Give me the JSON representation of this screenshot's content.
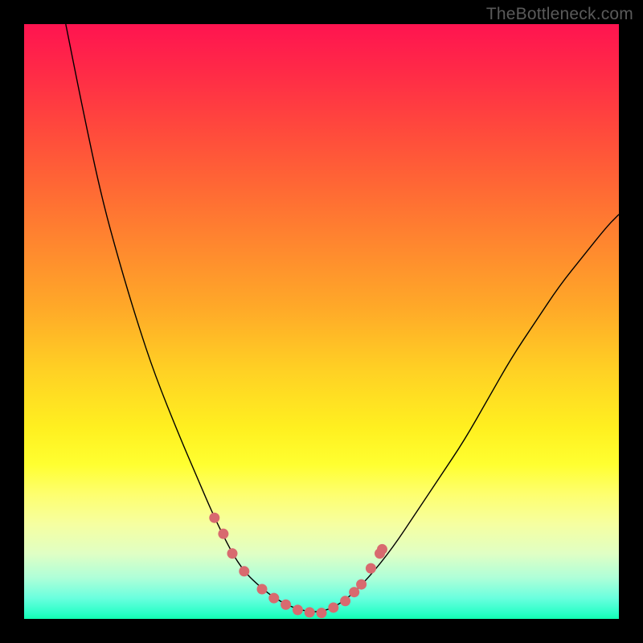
{
  "watermark": "TheBottleneck.com",
  "chart_data": {
    "type": "line",
    "title": "",
    "xlabel": "",
    "ylabel": "",
    "xlim": [
      0,
      100
    ],
    "ylim": [
      0,
      100
    ],
    "grid": false,
    "legend": false,
    "description": "V-shaped bottleneck curve over a vertical rainbow gradient (red top, green bottom); thin highlight strip near the bottom with salmon markers along the trough.",
    "series": [
      {
        "name": "curve",
        "x": [
          7,
          10,
          13,
          16,
          19,
          22,
          26,
          29,
          32,
          35,
          37,
          39,
          42,
          46,
          50,
          54,
          58,
          62,
          66,
          70,
          74,
          78,
          82,
          86,
          90,
          94,
          98,
          100
        ],
        "y": [
          100,
          85,
          71,
          60,
          50,
          41,
          31,
          24,
          17,
          11,
          8,
          6,
          3.5,
          1.5,
          1,
          3,
          7,
          12,
          18,
          24,
          30,
          37,
          44,
          50,
          56,
          61,
          66,
          68
        ]
      }
    ],
    "markers": [
      {
        "x": 32,
        "y": 17
      },
      {
        "x": 33.5,
        "y": 14.3
      },
      {
        "x": 35,
        "y": 11
      },
      {
        "x": 37,
        "y": 8
      },
      {
        "x": 40,
        "y": 5
      },
      {
        "x": 42,
        "y": 3.5
      },
      {
        "x": 44,
        "y": 2.4
      },
      {
        "x": 46,
        "y": 1.5
      },
      {
        "x": 48,
        "y": 1.1
      },
      {
        "x": 50,
        "y": 1
      },
      {
        "x": 52,
        "y": 1.9
      },
      {
        "x": 54,
        "y": 3
      },
      {
        "x": 55.5,
        "y": 4.5
      },
      {
        "x": 56.7,
        "y": 5.8
      },
      {
        "x": 58.3,
        "y": 8.5
      },
      {
        "x": 59.8,
        "y": 11
      },
      {
        "x": 60.2,
        "y": 11.7
      }
    ]
  }
}
